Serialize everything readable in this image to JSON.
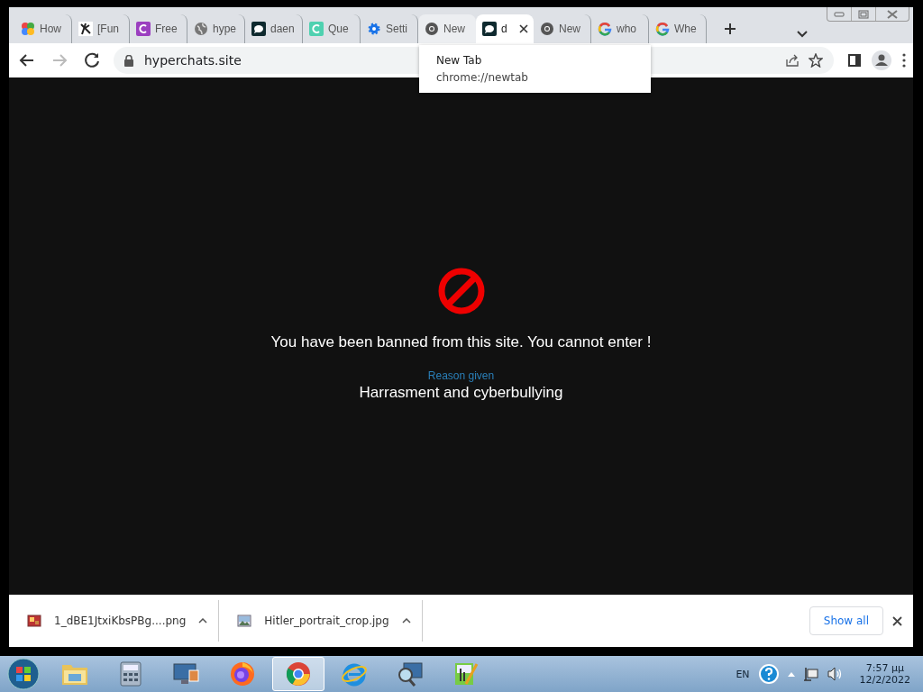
{
  "tabs": [
    {
      "label": "How",
      "kind": "pinwheel",
      "selected": false,
      "hovered": false
    },
    {
      "label": "[Fun",
      "kind": "figure",
      "selected": false,
      "hovered": false
    },
    {
      "label": "Free",
      "kind": "c-purple",
      "selected": false,
      "hovered": false
    },
    {
      "label": "hype",
      "kind": "globe",
      "selected": false,
      "hovered": false
    },
    {
      "label": "daen",
      "kind": "chat",
      "selected": false,
      "hovered": false
    },
    {
      "label": "Que",
      "kind": "c-teal",
      "selected": false,
      "hovered": false
    },
    {
      "label": "Setti",
      "kind": "gear",
      "selected": false,
      "hovered": false
    },
    {
      "label": "New",
      "kind": "chrome-dark",
      "selected": false,
      "hovered": true
    },
    {
      "label": "d",
      "kind": "chat",
      "selected": true,
      "hovered": false
    },
    {
      "label": "New",
      "kind": "chrome-dark",
      "selected": false,
      "hovered": false
    },
    {
      "label": "who",
      "kind": "google",
      "selected": false,
      "hovered": false
    },
    {
      "label": "Whe",
      "kind": "google",
      "selected": false,
      "hovered": false
    }
  ],
  "tooltip": {
    "title": "New Tab",
    "url": "chrome://newtab"
  },
  "address_bar": {
    "value": "hyperchats.site"
  },
  "page": {
    "message": "You have been banned from this site. You cannot enter !",
    "reason_label": "Reason given",
    "reason": "Harrasment and cyberbullying"
  },
  "downloads": [
    {
      "name": "1_dBE1JtxiKbsPBg....png",
      "kind": "image-red"
    },
    {
      "name": "Hitler_portrait_crop.jpg",
      "kind": "image-landscape"
    }
  ],
  "show_all": "Show all",
  "taskbar": {
    "apps": [
      {
        "kind": "folder",
        "active": false
      },
      {
        "kind": "calculator",
        "active": false
      },
      {
        "kind": "monitor",
        "active": false
      },
      {
        "kind": "firefox",
        "active": false
      },
      {
        "kind": "chrome",
        "active": true
      },
      {
        "kind": "ie",
        "active": false
      },
      {
        "kind": "magnifier",
        "active": false
      },
      {
        "kind": "notepad",
        "active": false
      }
    ],
    "language": "EN",
    "time": "7:57 μμ",
    "date": "12/2/2022"
  }
}
